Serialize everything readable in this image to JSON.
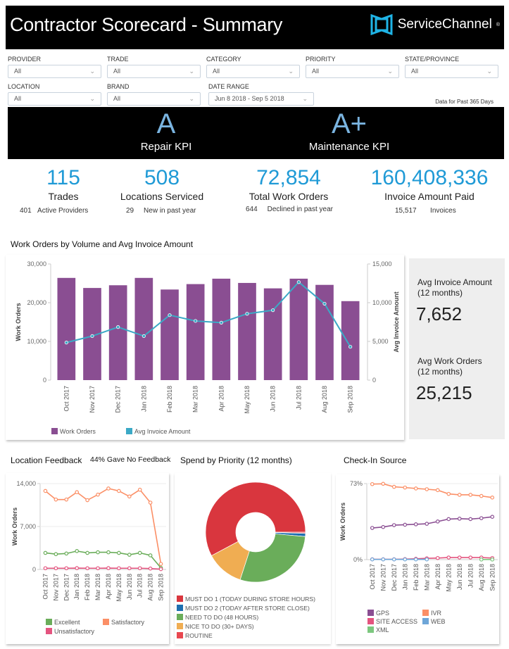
{
  "header": {
    "title": "Contractor Scorecard - Summary",
    "brand": "ServiceChannel",
    "brand_mark": "®",
    "logo_icon": "servicechannel-logo-icon"
  },
  "filters": [
    {
      "label": "PROVIDER",
      "value": "All"
    },
    {
      "label": "TRADE",
      "value": "All"
    },
    {
      "label": "CATEGORY",
      "value": "All"
    },
    {
      "label": "PRIORITY",
      "value": "All"
    },
    {
      "label": "STATE/PROVINCE",
      "value": "All"
    },
    {
      "label": "LOCATION",
      "value": "All"
    },
    {
      "label": "BRAND",
      "value": "All"
    },
    {
      "label": "DATE RANGE",
      "value": "Jun 8 2018 - Sep 5 2018"
    }
  ],
  "data_note": "Data for Past 365 Days",
  "kpis": [
    {
      "grade": "A",
      "name": "Repair KPI"
    },
    {
      "grade": "A+",
      "name": "Maintenance KPI"
    }
  ],
  "stats": [
    {
      "value": "115",
      "label": "Trades",
      "sub_value": "401",
      "sub_label": "Active Providers"
    },
    {
      "value": "508",
      "label": "Locations Serviced",
      "sub_value": "29",
      "sub_label": "New in past year"
    },
    {
      "value": "72,854",
      "label": "Total Work Orders",
      "sub_value": "644",
      "sub_label": "Declined in past year"
    },
    {
      "value": "160,408,336",
      "label": "Invoice Amount Paid",
      "sub_value": "15,517",
      "sub_label": "Invoices"
    }
  ],
  "side": {
    "avg_invoice_label": "Avg Invoice Amount",
    "avg_invoice_period": "(12 months)",
    "avg_invoice_value": "7,652",
    "avg_wo_label": "Avg Work Orders",
    "avg_wo_period": "(12 months)",
    "avg_wo_value": "25,215"
  },
  "location_feedback": {
    "title": "Location Feedback",
    "note": "44% Gave No Feedback"
  },
  "colors": {
    "work_orders": "#8a4e92",
    "avg_invoice": "#3ba9c6",
    "excellent": "#6aad5a",
    "satisfactory": "#fb8f66",
    "unsatisfactory": "#e4547f",
    "gps": "#8a4e92",
    "ivr": "#fb8f66",
    "site_access": "#e4547f",
    "web": "#6ea6d8",
    "xml": "#7cc77e",
    "must_do_1": "#d9363e",
    "must_do_2": "#1d6fb0",
    "need_to_do": "#6aad5a",
    "nice_to_do": "#f0ad52",
    "routine": "#e8474f",
    "kpi_grade": "#7ab4e0",
    "stat_value": "#1f9ad6"
  },
  "chart_data": [
    {
      "id": "wo_volume",
      "type": "bar",
      "title": "Work Orders by Volume and Avg Invoice Amount",
      "categories": [
        "Oct 2017",
        "Nov 2017",
        "Dec 2017",
        "Jan 2018",
        "Feb 2018",
        "Mar 2018",
        "Apr 2018",
        "May 2018",
        "Jun 2018",
        "Jul 2018",
        "Aug 2018",
        "Sep 2018"
      ],
      "series": [
        {
          "name": "Work Orders",
          "type": "bar",
          "axis": "left",
          "values": [
            26400,
            23800,
            24500,
            26400,
            23400,
            24800,
            26200,
            25100,
            23700,
            26200,
            24600,
            20400
          ]
        },
        {
          "name": "Avg Invoice Amount",
          "type": "line",
          "axis": "right",
          "values": [
            4850,
            5690,
            6850,
            5690,
            8390,
            7640,
            7420,
            8570,
            9030,
            12660,
            9870,
            4300
          ]
        }
      ],
      "ylabel": "Work Orders",
      "ylim": [
        0,
        30000
      ],
      "yticks": [
        "0",
        "10,000",
        "20,000",
        "30,000"
      ],
      "y2label": "Avg Invoice Amount",
      "y2lim": [
        0,
        15000
      ],
      "y2ticks": [
        "0",
        "5,000",
        "10,000",
        "15,000"
      ],
      "legend": "bottom"
    },
    {
      "id": "feedback",
      "type": "line",
      "title": "Location Feedback",
      "categories": [
        "Oct 2017",
        "Nov 2017",
        "Dec 2017",
        "Jan 2018",
        "Feb 2018",
        "Mar 2018",
        "Apr 2018",
        "May 2018",
        "Jun 2018",
        "Jul 2018",
        "Aug 2018",
        "Sep 2018"
      ],
      "series": [
        {
          "name": "Excellent",
          "values": [
            2700,
            2500,
            2600,
            3000,
            2700,
            2800,
            2800,
            2700,
            2400,
            2700,
            2300,
            260
          ]
        },
        {
          "name": "Satisfactory",
          "values": [
            12800,
            11400,
            11400,
            12600,
            11300,
            12200,
            13200,
            12800,
            11900,
            13000,
            10900,
            900
          ]
        },
        {
          "name": "Unsatisfactory",
          "values": [
            200,
            200,
            200,
            220,
            200,
            200,
            220,
            200,
            200,
            200,
            150,
            50
          ]
        }
      ],
      "ylabel": "Work Orders",
      "ylim": [
        0,
        14000
      ],
      "yticks": [
        "0",
        "7,000",
        "14,000"
      ],
      "legend": "bottom"
    },
    {
      "id": "spend_priority",
      "type": "pie",
      "title": "Spend by Priority (12 months)",
      "labels": [
        "ROUTINE",
        "MUST DO 2 (TODAY AFTER STORE CLOSE)",
        "NEED TO DO (48 HOURS)",
        "NICE TO DO (30+ DAYS)",
        "MUST DO 1 (TODAY DURING STORE HOURS)"
      ],
      "values": [
        0.4,
        1.0,
        28.6,
        12.2,
        57.8
      ],
      "legend_order": [
        "MUST DO 1 (TODAY DURING STORE HOURS)",
        "MUST DO 2 (TODAY AFTER STORE CLOSE)",
        "NEED TO DO (48 HOURS)",
        "NICE TO DO (30+ DAYS)",
        "ROUTINE"
      ],
      "donut": true,
      "legend": "bottom"
    },
    {
      "id": "checkin_source",
      "type": "line",
      "title": "Check-In Source",
      "categories": [
        "Oct 2017",
        "Nov 2017",
        "Dec 2017",
        "Jan 2018",
        "Feb 2018",
        "Mar 2018",
        "Apr 2018",
        "May 2018",
        "Jun 2018",
        "Jul 2018",
        "Aug 2018",
        "Sep 2018"
      ],
      "series": [
        {
          "name": "GPS",
          "values": [
            30.4,
            31.3,
            33.1,
            33.5,
            33.9,
            34.4,
            36.6,
            38.9,
            39.3,
            38.9,
            39.8,
            41.1
          ]
        },
        {
          "name": "IVR",
          "values": [
            72.5,
            72.8,
            69.9,
            69.2,
            68.3,
            67.6,
            66.7,
            63.1,
            62.2,
            62.2,
            61.1,
            59.6
          ]
        },
        {
          "name": "SITE ACCESS",
          "values": [
            0.3,
            0.3,
            0.3,
            0.5,
            0.8,
            1.2,
            1.5,
            2.0,
            2.0,
            2.0,
            2.0,
            1.5
          ]
        },
        {
          "name": "WEB",
          "values": [
            0.2,
            0.2,
            0.2,
            0.2,
            0.2,
            0.2,
            null,
            null,
            null,
            null,
            null,
            null
          ]
        },
        {
          "name": "XML",
          "values": [
            null,
            null,
            null,
            null,
            null,
            null,
            null,
            null,
            null,
            null,
            0.1,
            0.1
          ]
        }
      ],
      "ylabel": "Work Orders",
      "ylim": [
        0,
        73
      ],
      "yticks": [
        "0%",
        "73%"
      ],
      "legend": "bottom"
    }
  ]
}
